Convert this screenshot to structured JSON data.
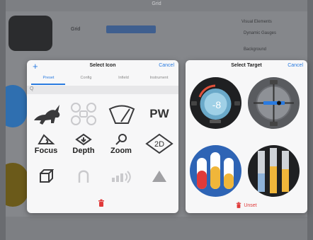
{
  "background": {
    "title": "Grid",
    "grid_label": "Grid",
    "panel_title": "Visual Elements",
    "panel_items": [
      "Dynamic Gauges",
      "Background"
    ]
  },
  "icon_popover": {
    "title": "Select Icon",
    "cancel_label": "Cancel",
    "add_label": "+",
    "tabs": [
      "Preset",
      "Config",
      "Infield",
      "Instrument"
    ],
    "search_glyph": "Q",
    "icons": [
      {
        "name": "rabbit-icon",
        "label": ""
      },
      {
        "name": "drone-icon",
        "label": ""
      },
      {
        "name": "wiper-icon",
        "label": ""
      },
      {
        "name": "pw-icon",
        "label": "PW"
      },
      {
        "name": "focus-icon",
        "label": "Focus"
      },
      {
        "name": "depth-icon",
        "label": "Depth"
      },
      {
        "name": "zoom-icon",
        "label": "Zoom"
      },
      {
        "name": "2d-icon",
        "label": "2D"
      },
      {
        "name": "cube-icon",
        "label": ""
      },
      {
        "name": "magnet-icon",
        "label": ""
      },
      {
        "name": "signal-icon",
        "label": ""
      },
      {
        "name": "triangle-icon",
        "label": ""
      }
    ],
    "delete_icon": "trash-icon"
  },
  "target_popover": {
    "title": "Select Target",
    "cancel_label": "Cancel",
    "gauge_value": "-8",
    "unset_label": "Unset"
  },
  "colors": {
    "accent": "#2a7be0",
    "danger": "#e03a3a",
    "icon_dark": "#3a3a3c",
    "icon_light": "#c9c9cc"
  }
}
